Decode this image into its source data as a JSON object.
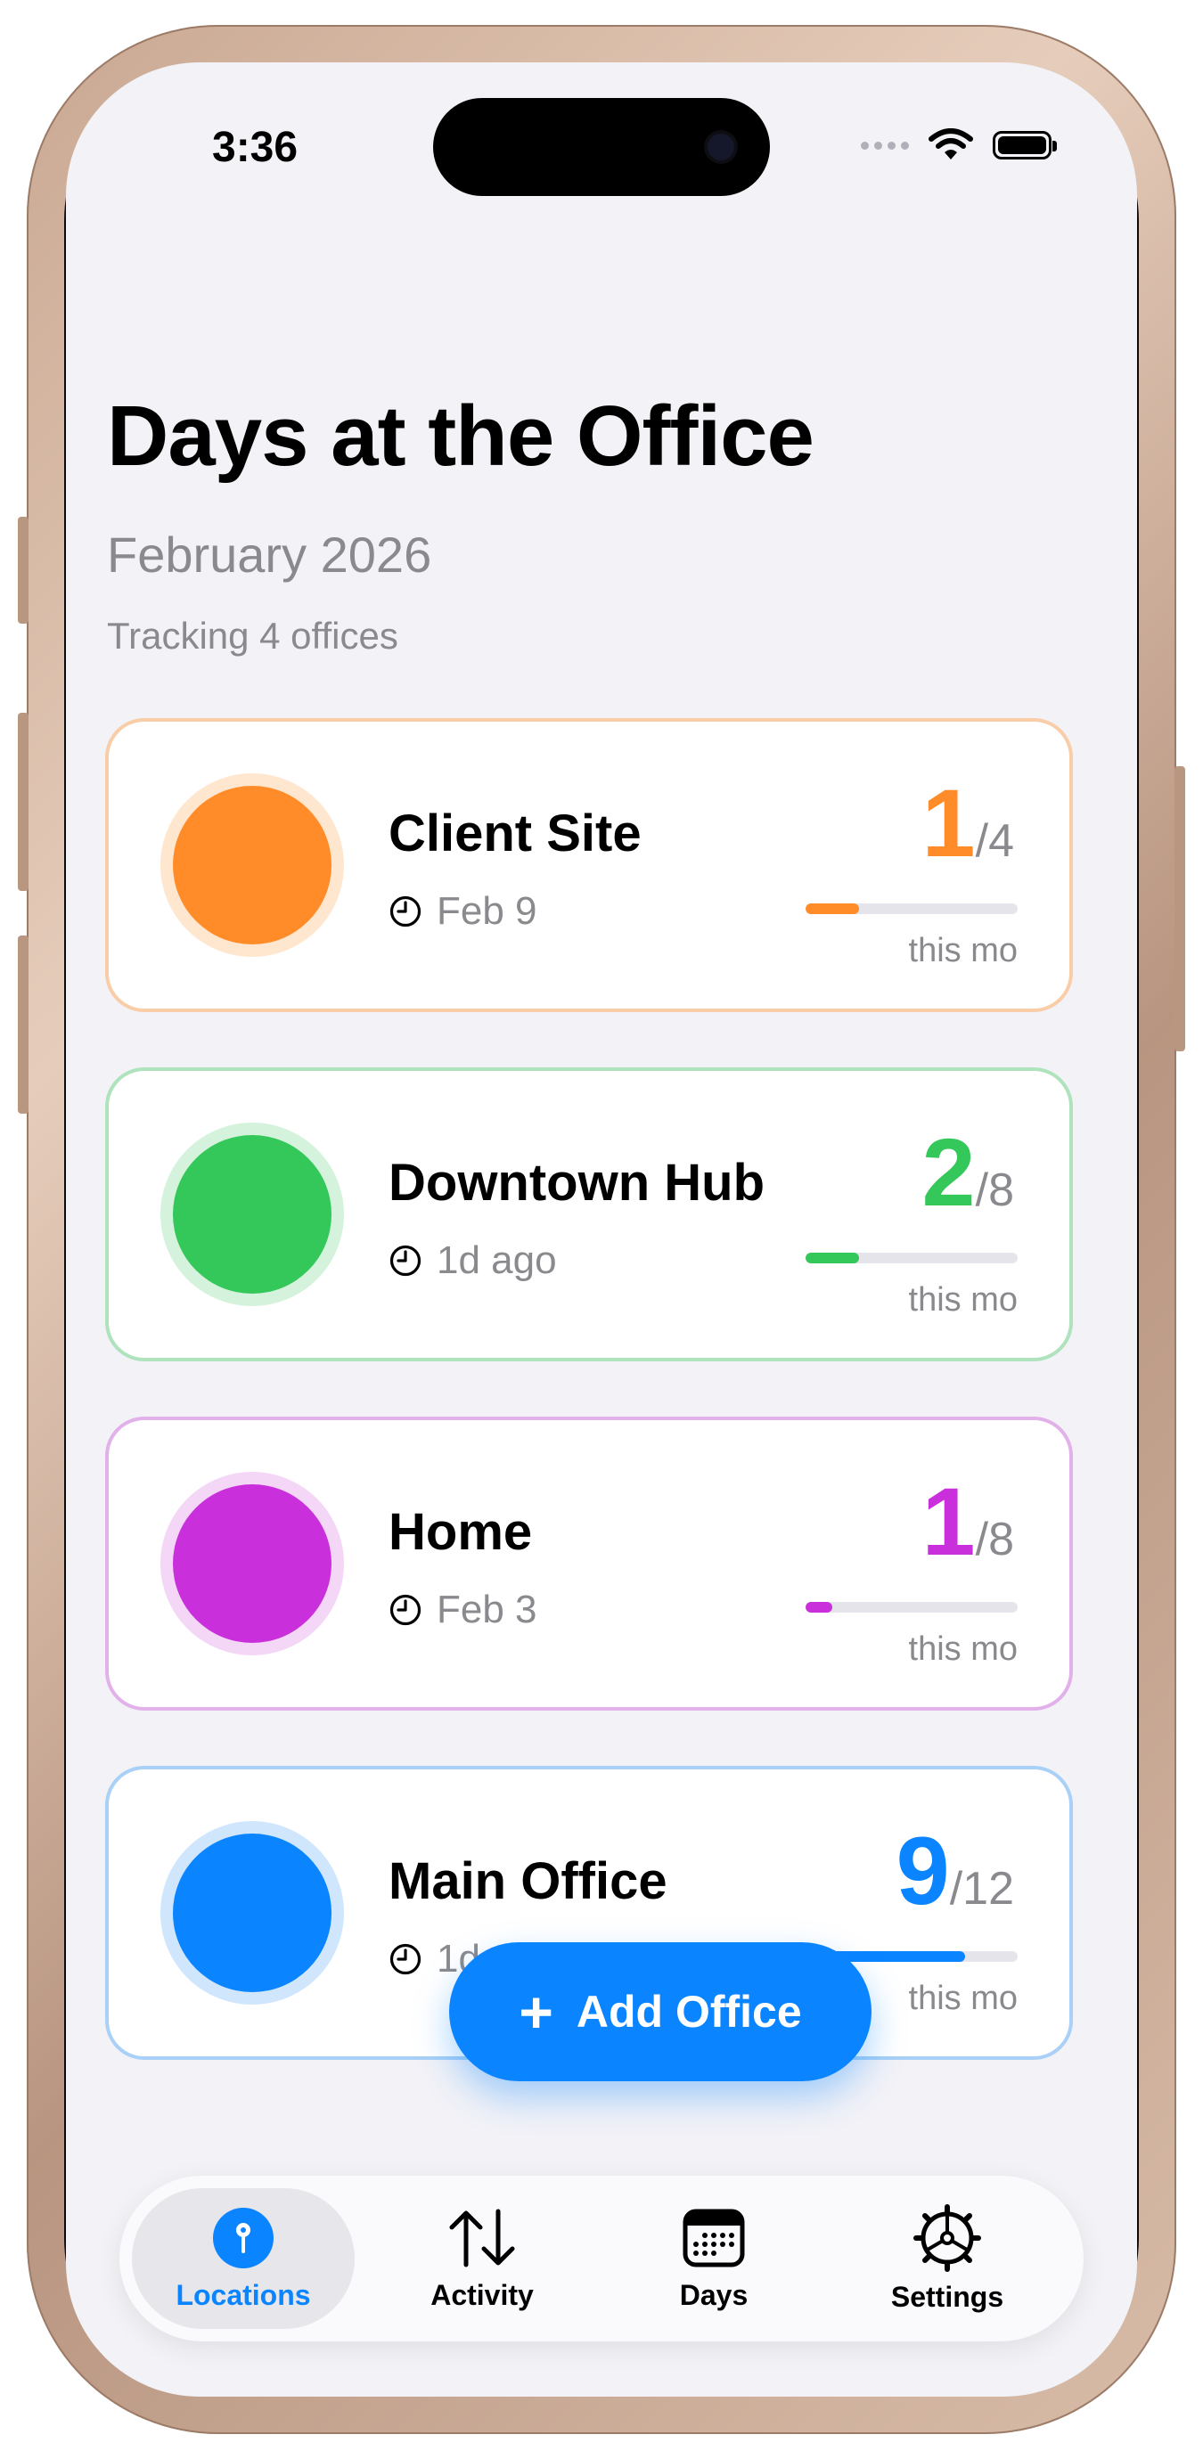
{
  "status_bar": {
    "time": "3:36"
  },
  "header": {
    "title": "Days at the Office",
    "month": "February 2026",
    "tracking": "Tracking 4 offices"
  },
  "offices": [
    {
      "name": "Client Site",
      "last_visit": "Feb 9",
      "count": "1",
      "target": "/4",
      "progress_fraction": 0.25,
      "period": "this mo",
      "color": "#ff8c28",
      "ring": "#ffe6cf",
      "border": "#f8cda8"
    },
    {
      "name": "Downtown Hub",
      "last_visit": "1d ago",
      "count": "2",
      "target": "/8",
      "progress_fraction": 0.25,
      "period": "this mo",
      "color": "#34c759",
      "ring": "#d5f3dc",
      "border": "#aee3bd"
    },
    {
      "name": "Home",
      "last_visit": "Feb 3",
      "count": "1",
      "target": "/8",
      "progress_fraction": 0.125,
      "period": "this mo",
      "color": "#c930db",
      "ring": "#f4d7f7",
      "border": "#e2b1ea"
    },
    {
      "name": "Main Office",
      "last_visit": "1d ago",
      "count": "9",
      "target": "/12",
      "progress_fraction": 0.75,
      "period": "this mo",
      "color": "#0a84ff",
      "ring": "#cfe6fd",
      "border": "#a9d0f6"
    }
  ],
  "add_button": {
    "label": "Add Office"
  },
  "tabs": [
    {
      "label": "Locations",
      "icon": "map-pin-icon",
      "active": true
    },
    {
      "label": "Activity",
      "icon": "arrows-up-down-icon",
      "active": false
    },
    {
      "label": "Days",
      "icon": "calendar-icon",
      "active": false
    },
    {
      "label": "Settings",
      "icon": "gear-icon",
      "active": false
    }
  ]
}
